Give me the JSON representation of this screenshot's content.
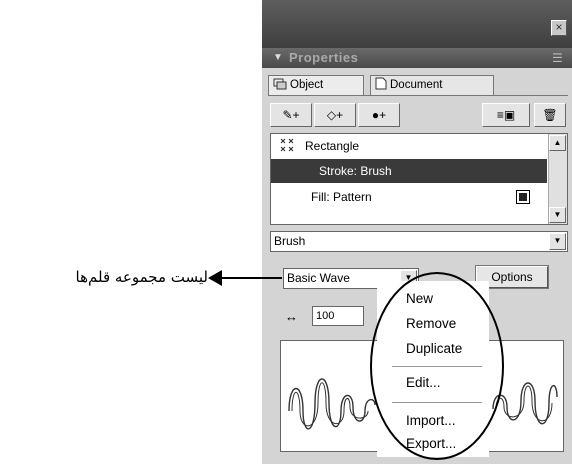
{
  "panel": {
    "title": "Properties",
    "close_glyph": "×",
    "collapse_arrow": "▼",
    "menu_glyph": "☰"
  },
  "tabs": [
    {
      "label": "Object",
      "icon": "object-icon"
    },
    {
      "label": "Document",
      "icon": "document-icon"
    }
  ],
  "toolbar": {
    "add_stroke_glyph": "✎+",
    "add_fill_glyph": "◇+",
    "add_effect_glyph": "●+",
    "right_glyph": "≡▣",
    "trash_glyph": "🗑"
  },
  "attributes": {
    "object_name": "Rectangle",
    "rows": [
      {
        "label": "Stroke: Brush",
        "selected": true
      },
      {
        "label": "Fill: Pattern",
        "selected": false
      }
    ],
    "scroll_up": "▲",
    "scroll_down": "▼"
  },
  "category_select": {
    "value": "Brush",
    "arrow": "▼"
  },
  "brush_library": {
    "value": "Basic Wave",
    "arrow": "▼"
  },
  "options_button": {
    "label": "Options"
  },
  "size": {
    "icon": "↔",
    "value": "100"
  },
  "context_menu": {
    "items": [
      "New",
      "Remove",
      "Duplicate",
      "Edit...",
      "Import...",
      "Export..."
    ]
  },
  "callout": {
    "text": "لیست مجموعه قلم‌ها"
  },
  "colors": {
    "titlebar": "#4a4a4a",
    "panel_bg": "#d4d4d4",
    "selection": "#3a3a3a"
  }
}
